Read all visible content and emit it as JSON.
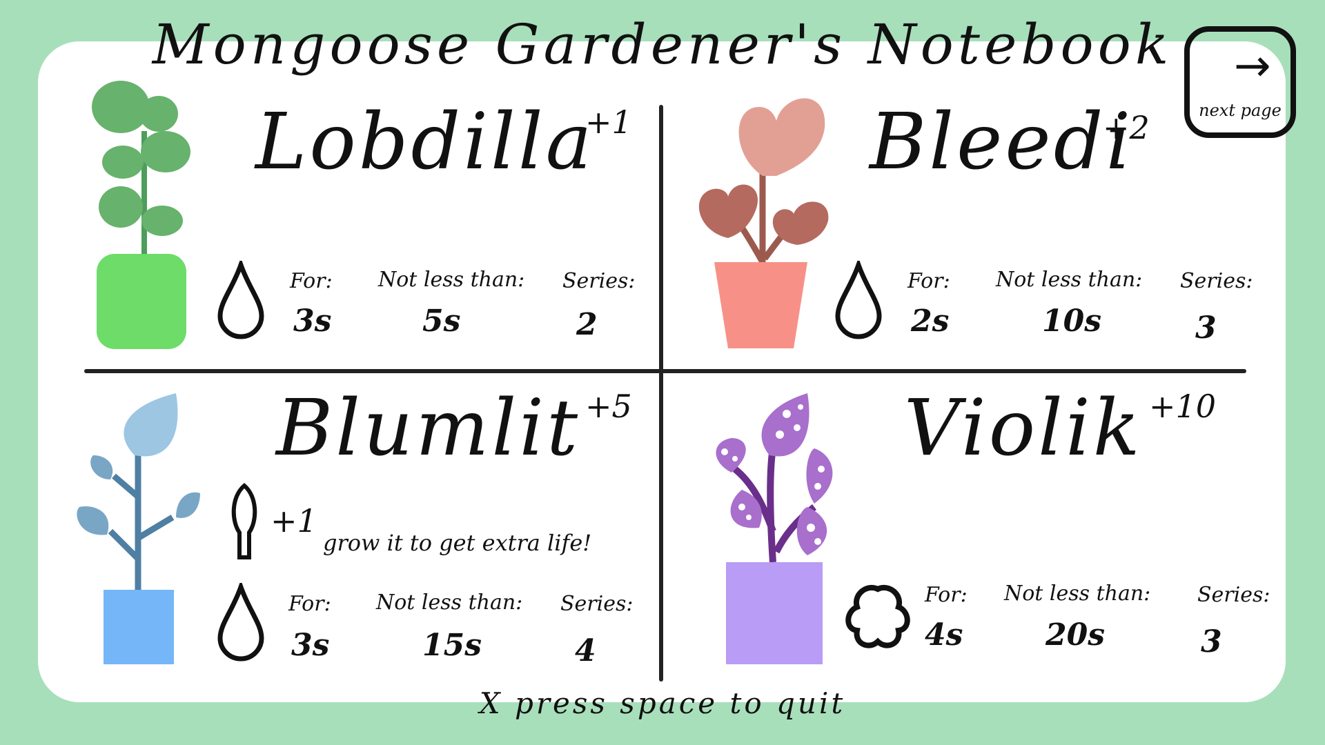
{
  "title": "Mongoose Gardener's Notebook",
  "next_page": {
    "label": "next page",
    "icon": "arrow-right-icon"
  },
  "quit_hint": "X press space to quit",
  "stat_labels": {
    "for": "For:",
    "min": "Not less than:",
    "series": "Series:"
  },
  "plants": [
    {
      "name": "Lobdilla",
      "bonus": "+1",
      "icon": "drop-icon",
      "for": "3s",
      "min": "5s",
      "series": "2",
      "colors": {
        "pot": "#6ddc68",
        "stem": "#4c9e5a",
        "leaf": "#67b26c"
      }
    },
    {
      "name": "Bleedi",
      "bonus": "+2",
      "icon": "drop-icon",
      "for": "2s",
      "min": "10s",
      "series": "3",
      "colors": {
        "pot": "#f79187",
        "stem": "#9c5a4e",
        "leaf": "#b56a5f",
        "leaf_top": "#e2a094"
      }
    },
    {
      "name": "Blumlit",
      "bonus": "+5",
      "icon": "drop-icon",
      "for": "3s",
      "min": "15s",
      "series": "4",
      "extra": {
        "icon": "trowel-icon",
        "value": "+1",
        "text": "grow it to get extra life!"
      },
      "colors": {
        "pot": "#75b6f8",
        "stem": "#4f7fa3",
        "leaf": "#7aa6c6",
        "leaf_top": "#9cc6e2"
      }
    },
    {
      "name": "Violik",
      "bonus": "+10",
      "icon": "flower-ring-icon",
      "for": "4s",
      "min": "20s",
      "series": "3",
      "colors": {
        "pot": "#b99cf5",
        "stem": "#6a2f8a",
        "leaf": "#a86fcc"
      }
    }
  ]
}
